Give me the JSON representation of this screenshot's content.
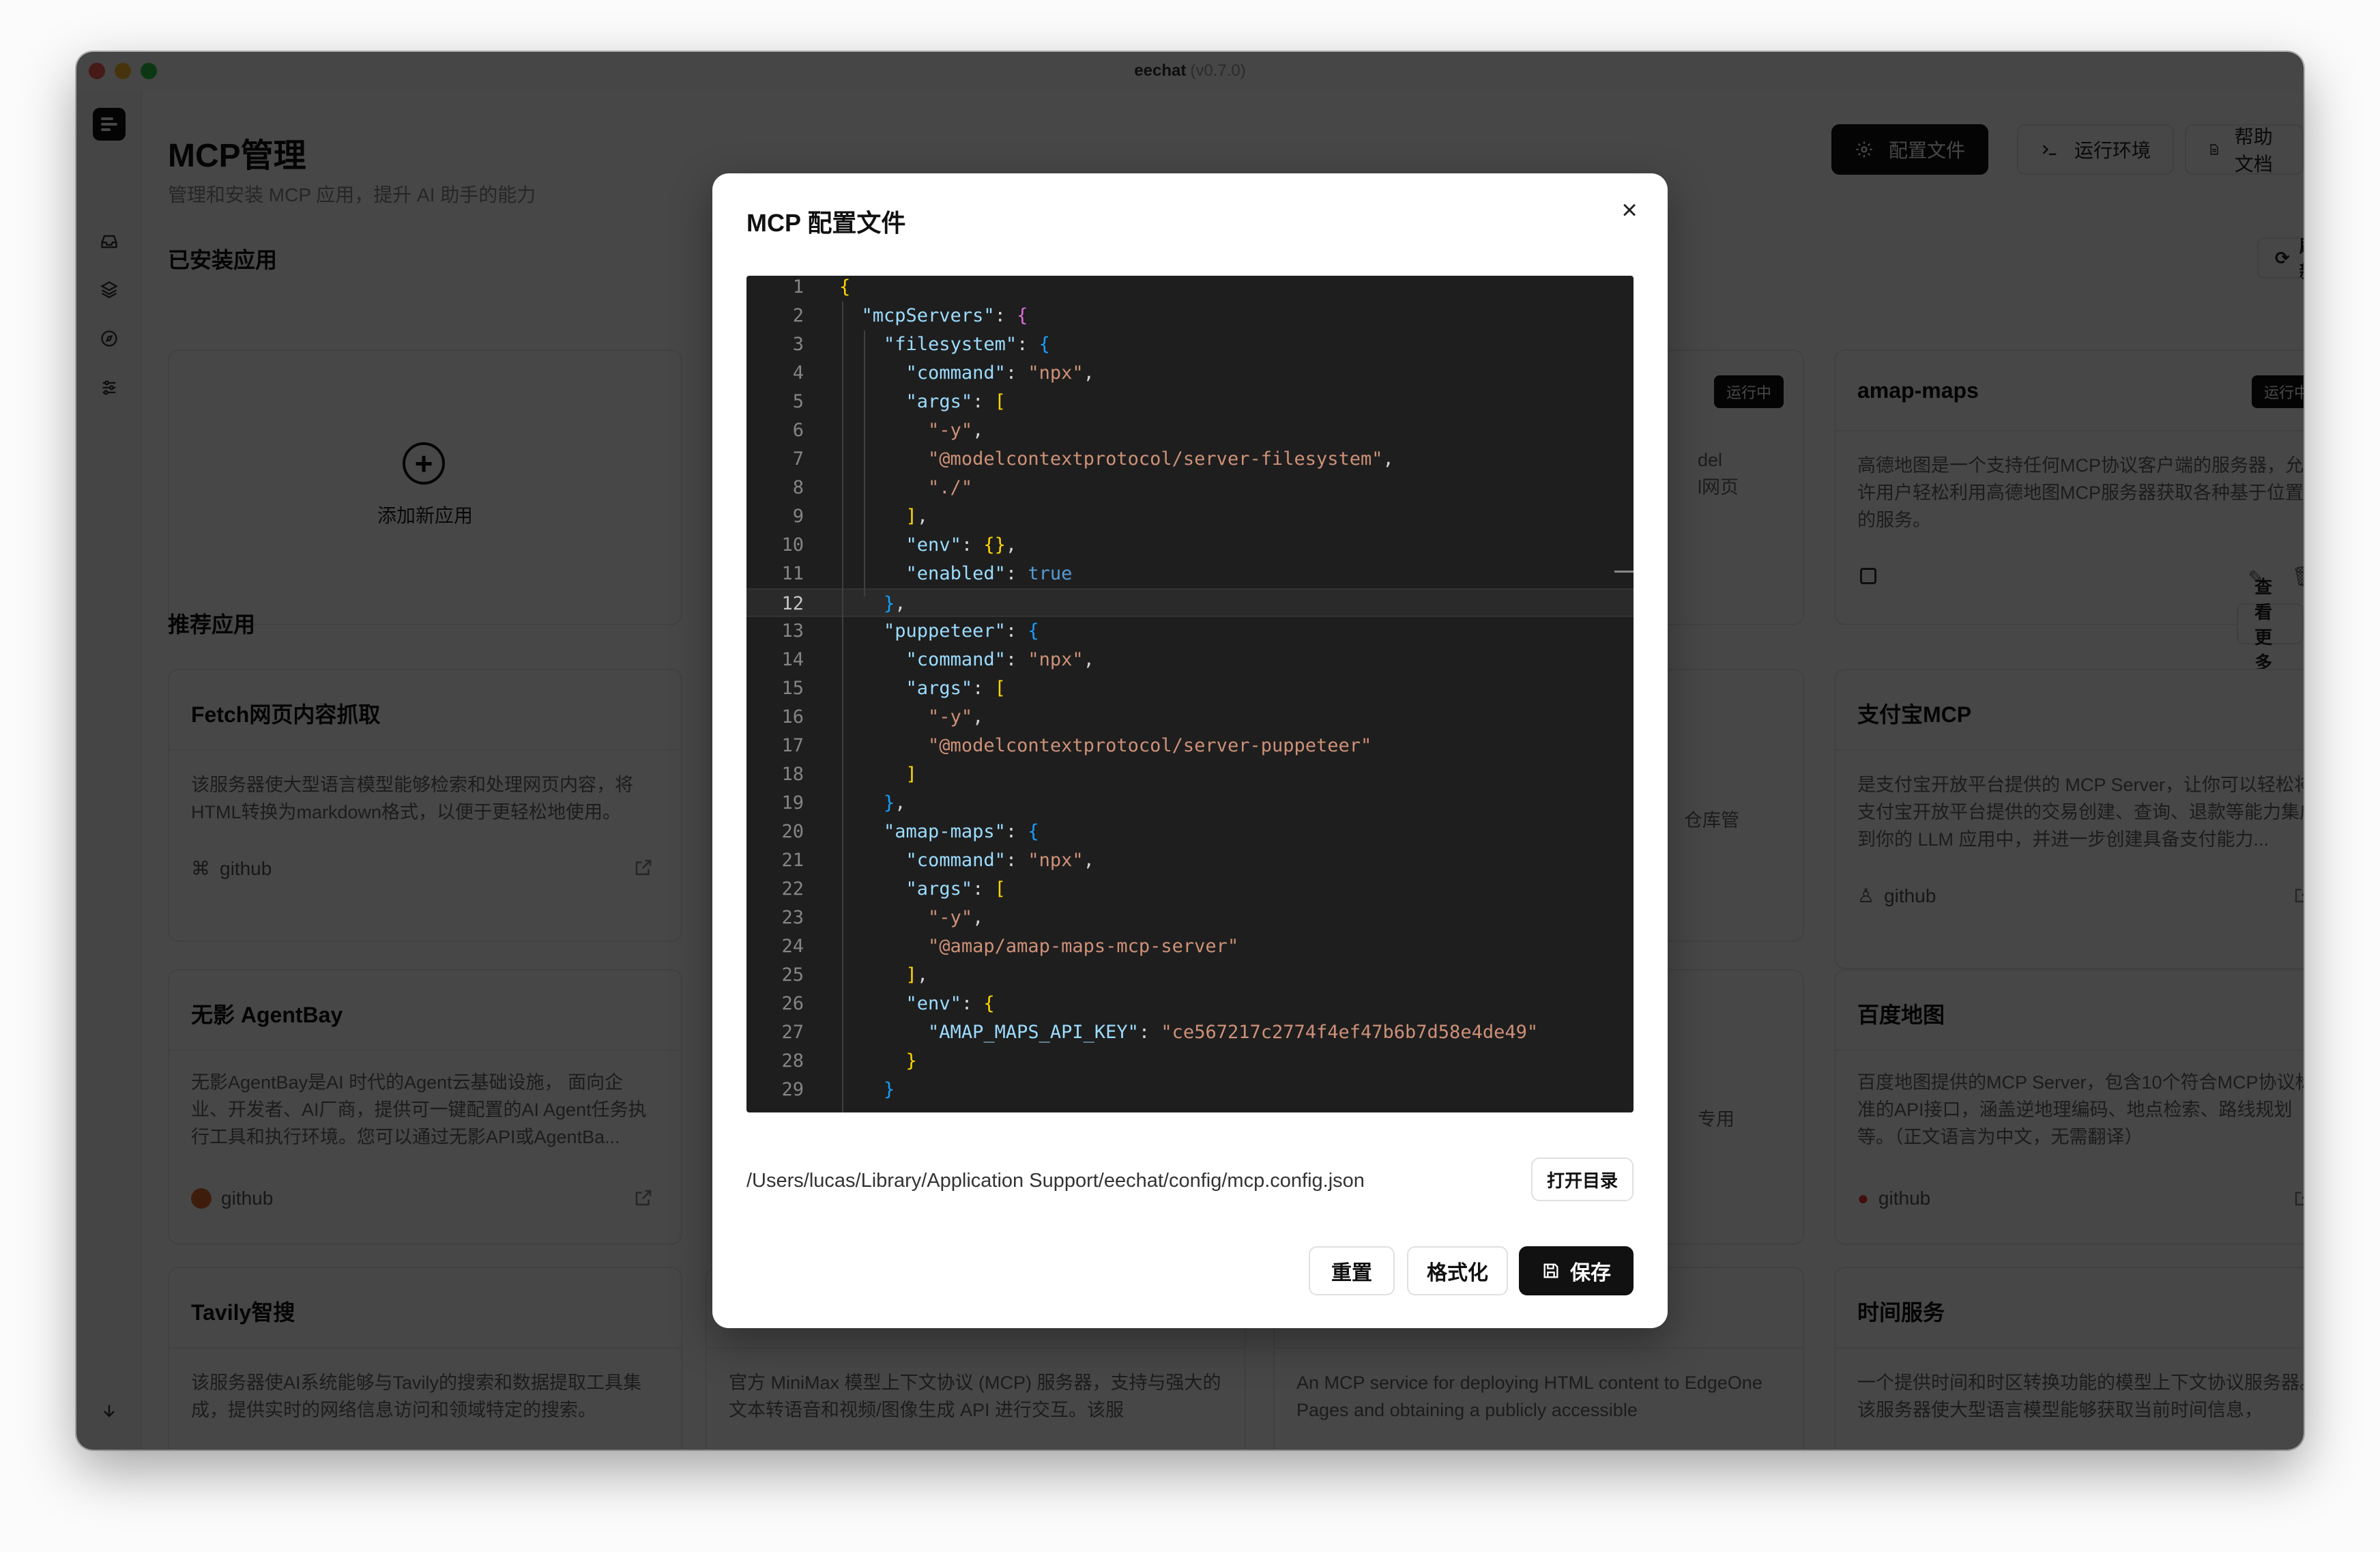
{
  "window": {
    "title": "eechat",
    "version": "(v0.7.0)"
  },
  "page": {
    "title": "MCP管理",
    "subtitle": "管理和安装 MCP 应用，提升 AI 助手的能力"
  },
  "header_buttons": {
    "config": "配置文件",
    "runtime": "运行环境",
    "help": "帮助文档"
  },
  "installed": {
    "title": "已安装应用",
    "refresh": "刷新",
    "add_label": "添加新应用",
    "apps": [
      {
        "name": "amap-maps",
        "status": "运行中",
        "desc": "高德地图是一个支持任何MCP协议客户端的服务器，允许用户轻松利用高德地图MCP服务器获取各种基于位置的服务。"
      },
      {
        "partial_desc_1": "del",
        "partial_desc_2": "l网页",
        "status": "运行中"
      }
    ]
  },
  "recommended": {
    "title": "推荐应用",
    "more": "查看更多",
    "apps": [
      {
        "name": "Fetch网页内容抓取",
        "desc": "该服务器使大型语言模型能够检索和处理网页内容，将HTML转换为markdown格式，以便于更轻松地使用。",
        "source": "github"
      },
      {
        "name": "支付宝MCP",
        "desc": "是支付宝开放平台提供的 MCP Server，让你可以轻松将支付宝开放平台提供的交易创建、查询、退款等能力集成到你的 LLM 应用中，并进一步创建具备支付能力...",
        "source": "github"
      },
      {
        "name": "无影 AgentBay",
        "desc": "无影AgentBay是AI 时代的Agent云基础设施， 面向企业、开发者、AI厂商，提供可一键配置的AI Agent任务执行工具和执行环境。您可以通过无影API或AgentBa...",
        "source": "github"
      },
      {
        "name": "百度地图",
        "desc": "百度地图提供的MCP Server，包含10个符合MCP协议标准的API接口，涵盖逆地理编码、地点检索、路线规划等。（正文语言为中文，无需翻译）",
        "source": "github"
      },
      {
        "name": "Tavily智搜",
        "desc": "该服务器使AI系统能够与Tavily的搜索和数据提取工具集成，提供实时的网络信息访问和领域特定的搜索。"
      },
      {
        "desc": "官方 MiniMax 模型上下文协议 (MCP) 服务器，支持与强大的文本转语音和视频/图像生成 API 进行交互。该服"
      },
      {
        "desc": "An MCP service for deploying HTML content to EdgeOne Pages and obtaining a publicly accessible"
      },
      {
        "name": "时间服务",
        "desc": "一个提供时间和时区转换功能的模型上下文协议服务器。该服务器使大型语言模型能够获取当前时间信息，"
      },
      {
        "partial_desc": "仓库管"
      },
      {
        "partial_desc": "专用"
      }
    ]
  },
  "modal": {
    "title": "MCP 配置文件",
    "path": "/Users/lucas/Library/Application Support/eechat/config/mcp.config.json",
    "open_dir": "打开目录",
    "reset": "重置",
    "format": "格式化",
    "save": "保存",
    "active_line": 12,
    "code_lines": [
      "{",
      "  \"mcpServers\": {",
      "    \"filesystem\": {",
      "      \"command\": \"npx\",",
      "      \"args\": [",
      "        \"-y\",",
      "        \"@modelcontextprotocol/server-filesystem\",",
      "        \"./\"",
      "      ],",
      "      \"env\": {},",
      "      \"enabled\": true",
      "    },",
      "    \"puppeteer\": {",
      "      \"command\": \"npx\",",
      "      \"args\": [",
      "        \"-y\",",
      "        \"@modelcontextprotocol/server-puppeteer\"",
      "      ]",
      "    },",
      "    \"amap-maps\": {",
      "      \"command\": \"npx\",",
      "      \"args\": [",
      "        \"-y\",",
      "        \"@amap/amap-maps-mcp-server\"",
      "      ],",
      "      \"env\": {",
      "        \"AMAP_MAPS_API_KEY\": \"ce567217c2774f4ef47b6b7d58e4de49\"",
      "      }",
      "    }"
    ]
  }
}
